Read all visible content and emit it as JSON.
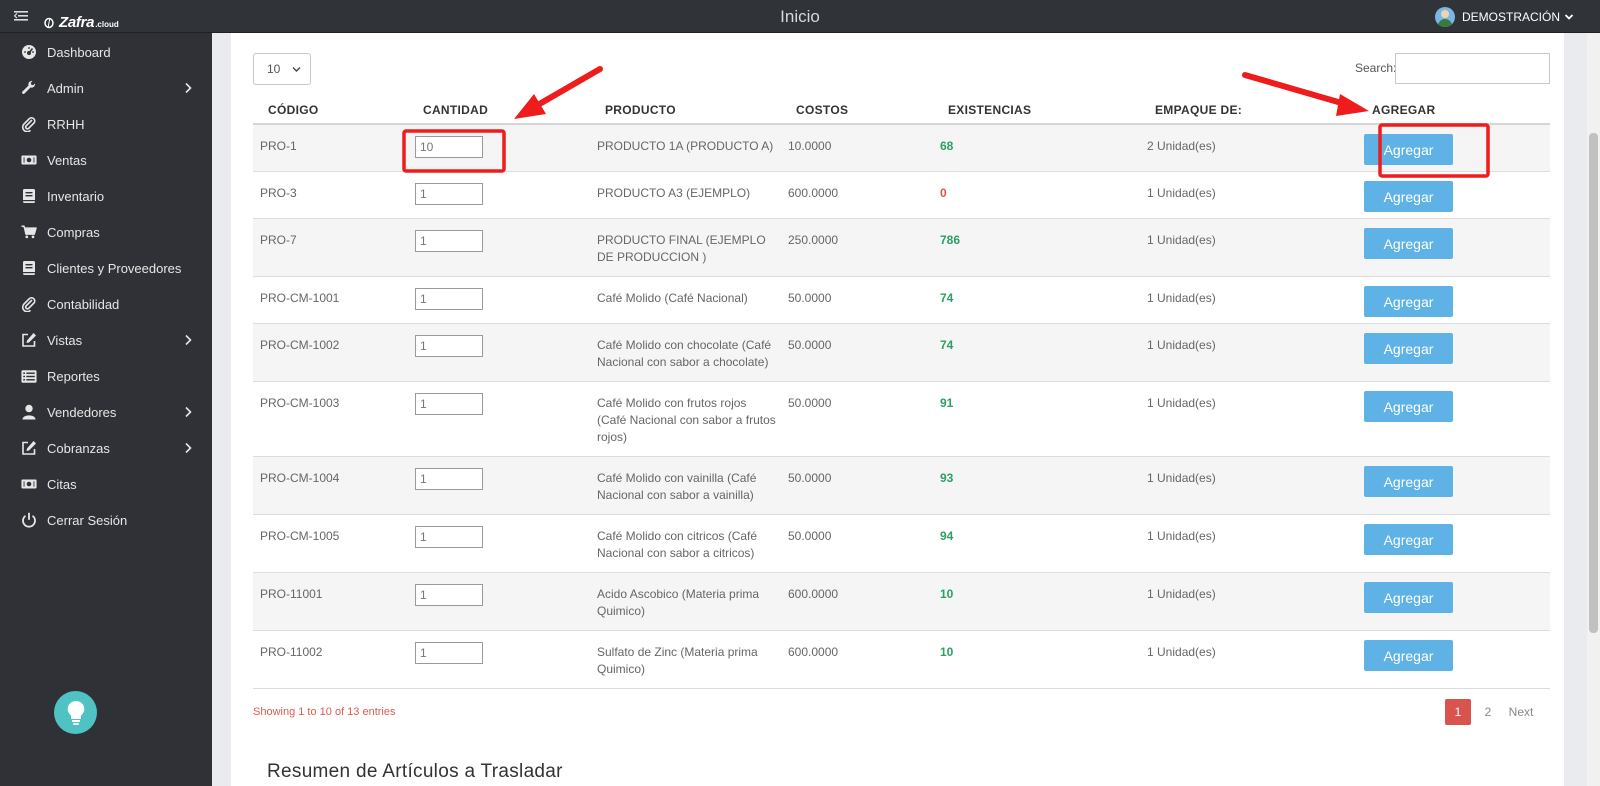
{
  "header": {
    "logo_text": "Zafra",
    "logo_sub": ".cloud",
    "title": "Inicio",
    "user_name": "DEMOSTRACIÓN"
  },
  "sidebar": {
    "items": [
      {
        "label": "Dashboard",
        "icon": "dashboard-icon",
        "has_submenu": false
      },
      {
        "label": "Admin",
        "icon": "wrench-icon",
        "has_submenu": true
      },
      {
        "label": "RRHH",
        "icon": "paperclip-icon",
        "has_submenu": false
      },
      {
        "label": "Ventas",
        "icon": "money-icon",
        "has_submenu": false
      },
      {
        "label": "Inventario",
        "icon": "book-icon",
        "has_submenu": false
      },
      {
        "label": "Compras",
        "icon": "cart-icon",
        "has_submenu": false
      },
      {
        "label": "Clientes y Proveedores",
        "icon": "book-icon",
        "has_submenu": false
      },
      {
        "label": "Contabilidad",
        "icon": "paperclip-icon",
        "has_submenu": false
      },
      {
        "label": "Vistas",
        "icon": "edit-icon",
        "has_submenu": true
      },
      {
        "label": "Reportes",
        "icon": "list-icon",
        "has_submenu": false
      },
      {
        "label": "Vendedores",
        "icon": "user-icon",
        "has_submenu": true
      },
      {
        "label": "Cobranzas",
        "icon": "edit-icon",
        "has_submenu": true
      },
      {
        "label": "Citas",
        "icon": "money-icon",
        "has_submenu": false
      },
      {
        "label": "Cerrar Sesión",
        "icon": "power-icon",
        "has_submenu": false
      }
    ]
  },
  "controls": {
    "page_length": "10",
    "search_label": "Search:",
    "search_value": ""
  },
  "table": {
    "headers": [
      "CÓDIGO",
      "CANTIDAD",
      "PRODUCTO",
      "COSTOS",
      "EXISTENCIAS",
      "EMPAQUE DE:",
      "AGREGAR"
    ],
    "button_label": "Agregar",
    "rows": [
      {
        "code": "PRO-1",
        "qty": "10",
        "product": "PRODUCTO 1A (PRODUCTO A)",
        "cost": "10.0000",
        "stock": "68",
        "pack": "2 Unidad(es)"
      },
      {
        "code": "PRO-3",
        "qty": "1",
        "product": "PRODUCTO A3 (EJEMPLO)",
        "cost": "600.0000",
        "stock": "0",
        "pack": "1 Unidad(es)"
      },
      {
        "code": "PRO-7",
        "qty": "1",
        "product": "PRODUCTO FINAL (EJEMPLO DE PRODUCCION )",
        "cost": "250.0000",
        "stock": "786",
        "pack": "1 Unidad(es)"
      },
      {
        "code": "PRO-CM-1001",
        "qty": "1",
        "product": "Café Molido (Café Nacional)",
        "cost": "50.0000",
        "stock": "74",
        "pack": "1 Unidad(es)"
      },
      {
        "code": "PRO-CM-1002",
        "qty": "1",
        "product": "Café Molido con chocolate (Café Nacional con sabor a chocolate)",
        "cost": "50.0000",
        "stock": "74",
        "pack": "1 Unidad(es)"
      },
      {
        "code": "PRO-CM-1003",
        "qty": "1",
        "product": "Café Molido con frutos rojos (Café Nacional con sabor a frutos rojos)",
        "cost": "50.0000",
        "stock": "91",
        "pack": "1 Unidad(es)"
      },
      {
        "code": "PRO-CM-1004",
        "qty": "1",
        "product": "Café Molido con vainilla (Café Nacional con sabor a vainilla)",
        "cost": "50.0000",
        "stock": "93",
        "pack": "1 Unidad(es)"
      },
      {
        "code": "PRO-CM-1005",
        "qty": "1",
        "product": "Café Molido con citricos (Café Nacional con sabor a citricos)",
        "cost": "50.0000",
        "stock": "94",
        "pack": "1 Unidad(es)"
      },
      {
        "code": "PRO-11001",
        "qty": "1",
        "product": "Acido Ascobico (Materia prima Quimico)",
        "cost": "600.0000",
        "stock": "10",
        "pack": "1 Unidad(es)"
      },
      {
        "code": "PRO-11002",
        "qty": "1",
        "product": "Sulfato de Zinc (Materia prima Quimico)",
        "cost": "600.0000",
        "stock": "10",
        "pack": "1 Unidad(es)"
      }
    ]
  },
  "footer": {
    "info": "Showing 1 to 10 of 13 entries",
    "pages": [
      "1",
      "2"
    ],
    "current_page": "1",
    "next_label": "Next"
  },
  "section_title": "Resumen de Artículos a Trasladar",
  "colors": {
    "sidebar_bg": "#2f3136",
    "button_bg": "#5fb2e6",
    "stock_positive": "#2e9e64",
    "stock_zero": "#d9534f",
    "annotation_red": "#ee1c1c",
    "active_page": "#d9534f"
  }
}
